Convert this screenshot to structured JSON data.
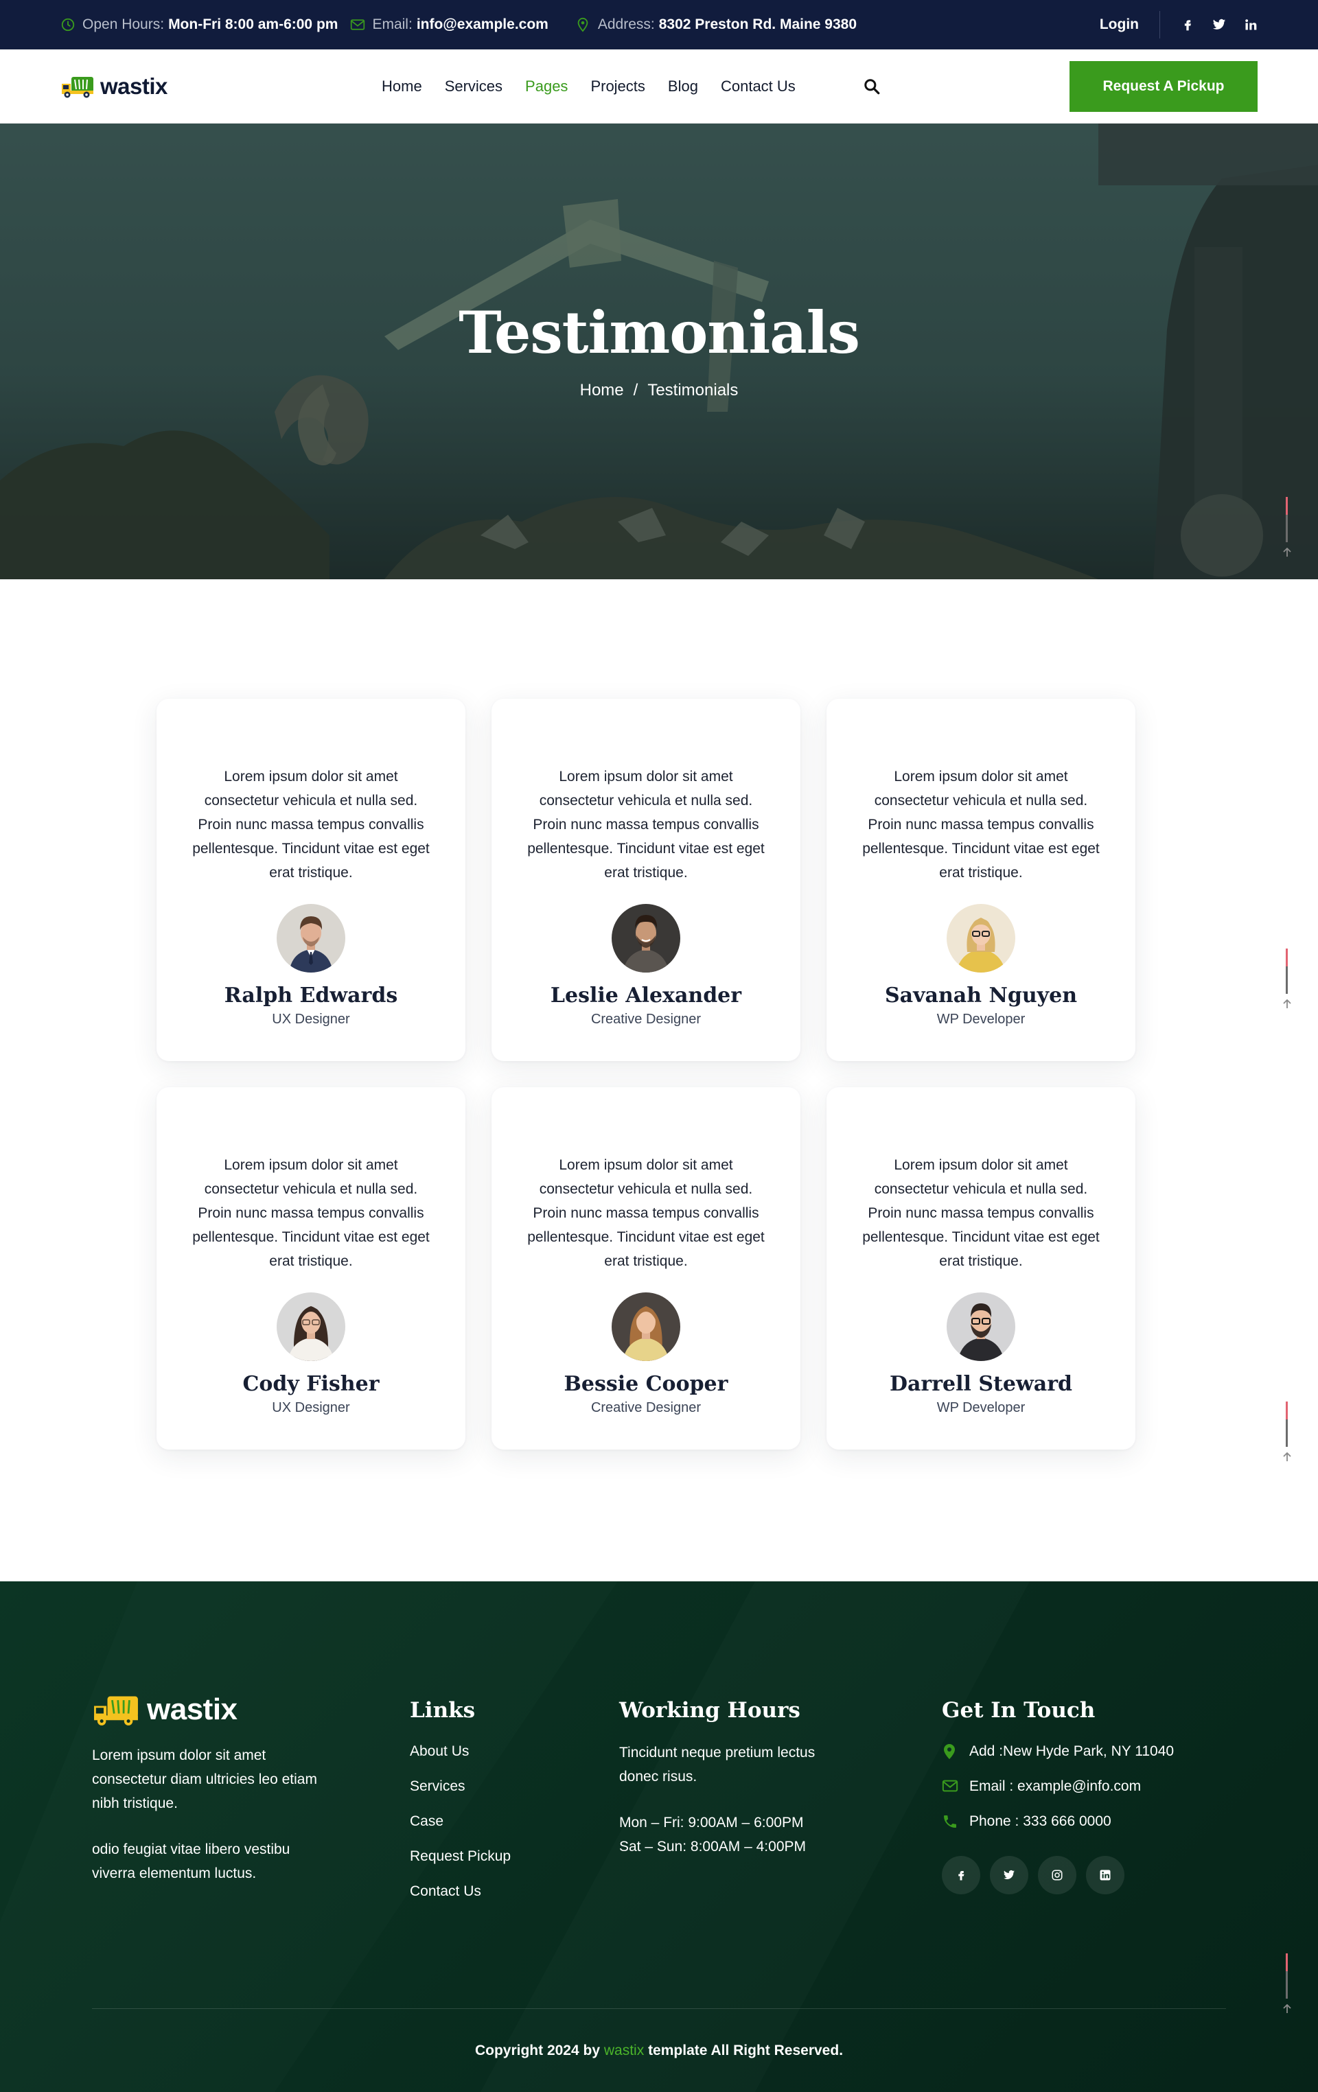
{
  "topbar": {
    "open_label": "Open Hours:",
    "open_value": "Mon-Fri 8:00 am-6:00 pm",
    "email_label": "Email:",
    "email_value": "info@example.com",
    "address_label": "Address:",
    "address_value": "8302 Preston Rd. Maine 9380",
    "login": "Login",
    "social_icons": [
      "facebook-icon",
      "twitter-icon",
      "linkedin-icon"
    ]
  },
  "nav": {
    "logo": "wastix",
    "menu": [
      "Home",
      "Services",
      "Pages",
      "Projects",
      "Blog",
      "Contact Us"
    ],
    "active": "Pages",
    "cta": "Request A Pickup"
  },
  "hero": {
    "title": "Testimonials",
    "breadcrumb": [
      "Home",
      "/",
      "Testimonials"
    ]
  },
  "testimonials": [
    {
      "quote": "Lorem ipsum dolor sit amet consectetur vehicula et nulla sed. Proin nunc massa tempus convallis pellentesque. Tincidunt vitae est eget erat tristique.",
      "name": "Ralph Edwards",
      "role": "UX Designer"
    },
    {
      "quote": "Lorem ipsum dolor sit amet consectetur vehicula et nulla sed. Proin nunc massa tempus convallis pellentesque. Tincidunt vitae est eget erat tristique.",
      "name": "Leslie Alexander",
      "role": "Creative Designer"
    },
    {
      "quote": "Lorem ipsum dolor sit amet consectetur vehicula et nulla sed. Proin nunc massa tempus convallis pellentesque. Tincidunt vitae est eget erat tristique.",
      "name": "Savanah Nguyen",
      "role": "WP Developer"
    },
    {
      "quote": "Lorem ipsum dolor sit amet consectetur vehicula et nulla sed. Proin nunc massa tempus convallis pellentesque. Tincidunt vitae est eget erat tristique.",
      "name": "Cody Fisher",
      "role": "UX Designer"
    },
    {
      "quote": "Lorem ipsum dolor sit amet consectetur vehicula et nulla sed. Proin nunc massa tempus convallis pellentesque. Tincidunt vitae est eget erat tristique.",
      "name": "Bessie Cooper",
      "role": "Creative Designer"
    },
    {
      "quote": "Lorem ipsum dolor sit amet consectetur vehicula et nulla sed. Proin nunc massa tempus convallis pellentesque. Tincidunt vitae est eget erat tristique.",
      "name": "Darrell Steward",
      "role": "WP Developer"
    }
  ],
  "footer": {
    "logo": "wastix",
    "about_1": "Lorem ipsum dolor sit amet consectetur diam ultricies leo etiam nibh tristique.",
    "about_2": "odio feugiat vitae libero vestibu viverra elementum luctus.",
    "links_title": "Links",
    "links": [
      "About Us",
      "Services",
      "Case",
      "Request Pickup",
      "Contact Us"
    ],
    "hours_title": "Working Hours",
    "hours_intro": "Tincidunt neque pretium lectus donec risus.",
    "hours_weekday": "Mon – Fri: 9:00AM – 6:00PM",
    "hours_weekend": "Sat – Sun: 8:00AM – 4:00PM",
    "touch_title": "Get In Touch",
    "address": "Add :New Hyde Park, NY 11040",
    "email": "Email : example@info.com",
    "phone": "Phone : 333 666 0000",
    "social_icons": [
      "facebook-icon",
      "twitter-icon",
      "instagram-icon",
      "linkedin-icon"
    ],
    "copyright_pre": "Copyright 2024 by",
    "copyright_brand": "wastix",
    "copyright_post": "template All Right Reserved."
  },
  "colors": {
    "brand_green": "#3a9b1d",
    "topbar_navy": "#111c3d",
    "footer_green": "#0a2f20"
  }
}
